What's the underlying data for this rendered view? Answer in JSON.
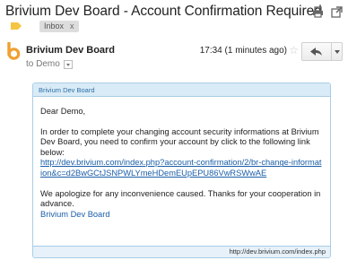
{
  "message": {
    "subject": "Brivium Dev Board - Account Confirmation Required",
    "labels": [
      {
        "name": "Inbox",
        "remove": "x"
      }
    ],
    "icons": {
      "print": "print-icon",
      "new_window": "open-in-new-window-icon",
      "label": "label-tag-icon",
      "sender": "brivium-logo-icon",
      "star": "star-icon",
      "reply": "reply-icon",
      "more": "chevron-down-icon"
    },
    "sender": {
      "name": "Brivium Dev Board",
      "to": "to Demo"
    },
    "timestamp": "17:34 (1 minutes ago)",
    "star": "☆"
  },
  "email": {
    "header": "Brivium Dev Board",
    "greeting": "Dear Demo,",
    "body": "In order to complete your changing account security informations at Brivium Dev Board, you need to confirm your account by click to the following link below:",
    "link": "http://dev.brivium.com/index.php?account-confirmation/2/br-change-information&c=d2BwGCtJSNPWLYmeHDemEUpEPU86VwRSWwAE",
    "closing": "We apologize for any inconvenience caused. Thanks for your cooperation in advance.",
    "signature": "Brivium Dev Board",
    "footer": "http://dev.brivium.com/index.php"
  },
  "colors": {
    "accent": "#1a5ea8",
    "header_bg": "#d9ebf7",
    "border": "#a9cde6",
    "logo": "#f0a030"
  }
}
